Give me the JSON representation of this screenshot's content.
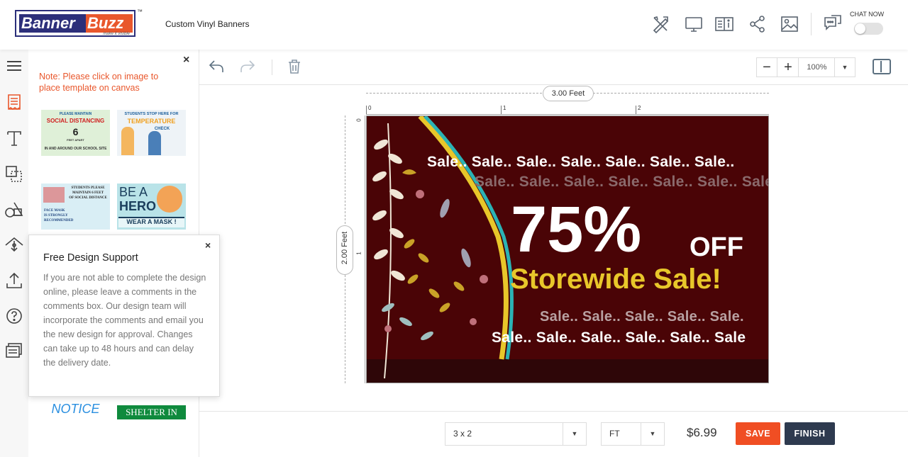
{
  "header": {
    "logo": {
      "part1": "Banner",
      "part2": "Buzz",
      "tagline": "make it visible",
      "tm": "™"
    },
    "title": "Custom Vinyl Banners",
    "icons": [
      "design-tools-icon",
      "desktop-preview-icon",
      "book-info-icon",
      "share-icon",
      "image-icon",
      "chat-icon"
    ],
    "chat_label": "CHAT NOW"
  },
  "rail": {
    "icons": [
      "menu-icon",
      "templates-icon",
      "text-icon",
      "shapes-icon",
      "clipart-icon",
      "background-icon",
      "upload-icon",
      "help-icon",
      "comments-icon"
    ]
  },
  "panel": {
    "close": "×",
    "note": "Note: Please click on image to place template on canvas",
    "templates": [
      {
        "lines": [
          "PLEASE MAINTAIN",
          "SOCIAL DISTANCING",
          "6",
          "FEET APART",
          "IN AND AROUND OUR SCHOOL SITE"
        ]
      },
      {
        "lines": [
          "STUDENTS STOP HERE FOR",
          "TEMPERATURE",
          "CHECK"
        ]
      },
      {
        "lines": [
          "STUDENTS PLEASE",
          "MAINTAIN 6 FEET",
          "OF SOCIAL DISTANCE",
          "FACE MASK",
          "IS STRONGLY",
          "RECOMMENDED"
        ]
      },
      {
        "lines": [
          "BE A",
          "HERO",
          "WEAR A MASK !"
        ]
      },
      {
        "lines": [
          "NOTICE"
        ]
      },
      {
        "lines": [
          "SHELTER IN"
        ]
      }
    ]
  },
  "support": {
    "close": "×",
    "title": "Free Design Support",
    "body": "If you are not able to complete the design online, please leave a comments in the comments box. Our design team will incorporate the comments and email you the new design for approval. Changes can take up to 48 hours and can delay the delivery date."
  },
  "toolbar": {
    "zoom_minus": "−",
    "zoom_plus": "+",
    "zoom_value": "100%",
    "dropdown": "▼"
  },
  "canvas": {
    "width_label": "3.00 Feet",
    "height_label": "2.00 Feet",
    "ruler_top": [
      "0",
      "1",
      "2"
    ],
    "ruler_left": [
      "0",
      "1"
    ]
  },
  "banner": {
    "sale_row1": "Sale.. Sale.. Sale.. Sale.. Sale.. Sale.. Sale..",
    "sale_row2": "Sale.. Sale.. Sale.. Sale.. Sale.. Sale.. Sale..",
    "percent": "75%",
    "off": "OFF",
    "headline": "Storewide Sale!",
    "sale_row3": "Sale.. Sale.. Sale.. Sale.. Sale.",
    "sale_row4": "Sale.. Sale.. Sale.. Sale.. Sale.. Sale"
  },
  "bottom": {
    "size": "3 x 2",
    "unit": "FT",
    "dropdown": "▼",
    "price": "$6.99",
    "save": "SAVE",
    "finish": "FINISH"
  },
  "colors": {
    "accent": "#f04e23",
    "note": "#e9572c",
    "dark": "#2e3a4f",
    "banner_bg": "#4a0406",
    "headline": "#e8c72a"
  }
}
